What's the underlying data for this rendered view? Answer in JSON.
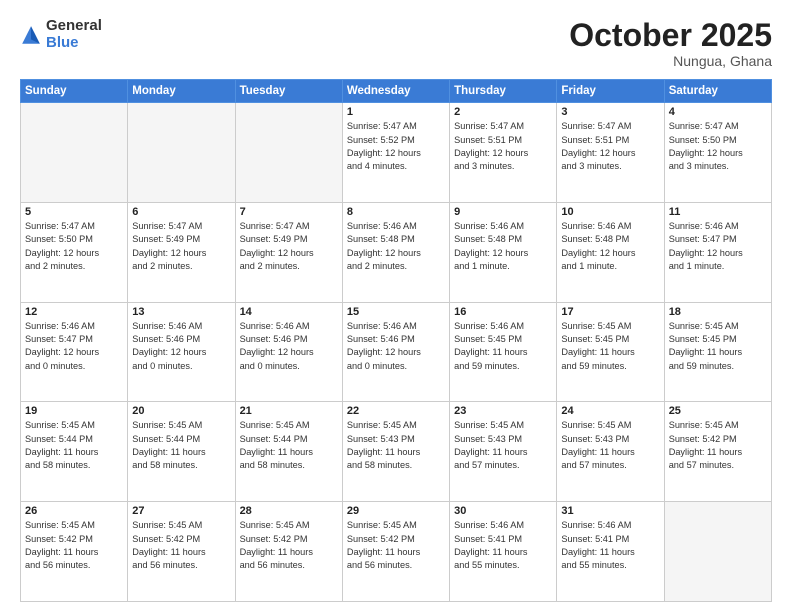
{
  "logo": {
    "general": "General",
    "blue": "Blue"
  },
  "header": {
    "month": "October 2025",
    "location": "Nungua, Ghana"
  },
  "weekdays": [
    "Sunday",
    "Monday",
    "Tuesday",
    "Wednesday",
    "Thursday",
    "Friday",
    "Saturday"
  ],
  "weeks": [
    [
      {
        "day": "",
        "info": ""
      },
      {
        "day": "",
        "info": ""
      },
      {
        "day": "",
        "info": ""
      },
      {
        "day": "1",
        "info": "Sunrise: 5:47 AM\nSunset: 5:52 PM\nDaylight: 12 hours\nand 4 minutes."
      },
      {
        "day": "2",
        "info": "Sunrise: 5:47 AM\nSunset: 5:51 PM\nDaylight: 12 hours\nand 3 minutes."
      },
      {
        "day": "3",
        "info": "Sunrise: 5:47 AM\nSunset: 5:51 PM\nDaylight: 12 hours\nand 3 minutes."
      },
      {
        "day": "4",
        "info": "Sunrise: 5:47 AM\nSunset: 5:50 PM\nDaylight: 12 hours\nand 3 minutes."
      }
    ],
    [
      {
        "day": "5",
        "info": "Sunrise: 5:47 AM\nSunset: 5:50 PM\nDaylight: 12 hours\nand 2 minutes."
      },
      {
        "day": "6",
        "info": "Sunrise: 5:47 AM\nSunset: 5:49 PM\nDaylight: 12 hours\nand 2 minutes."
      },
      {
        "day": "7",
        "info": "Sunrise: 5:47 AM\nSunset: 5:49 PM\nDaylight: 12 hours\nand 2 minutes."
      },
      {
        "day": "8",
        "info": "Sunrise: 5:46 AM\nSunset: 5:48 PM\nDaylight: 12 hours\nand 2 minutes."
      },
      {
        "day": "9",
        "info": "Sunrise: 5:46 AM\nSunset: 5:48 PM\nDaylight: 12 hours\nand 1 minute."
      },
      {
        "day": "10",
        "info": "Sunrise: 5:46 AM\nSunset: 5:48 PM\nDaylight: 12 hours\nand 1 minute."
      },
      {
        "day": "11",
        "info": "Sunrise: 5:46 AM\nSunset: 5:47 PM\nDaylight: 12 hours\nand 1 minute."
      }
    ],
    [
      {
        "day": "12",
        "info": "Sunrise: 5:46 AM\nSunset: 5:47 PM\nDaylight: 12 hours\nand 0 minutes."
      },
      {
        "day": "13",
        "info": "Sunrise: 5:46 AM\nSunset: 5:46 PM\nDaylight: 12 hours\nand 0 minutes."
      },
      {
        "day": "14",
        "info": "Sunrise: 5:46 AM\nSunset: 5:46 PM\nDaylight: 12 hours\nand 0 minutes."
      },
      {
        "day": "15",
        "info": "Sunrise: 5:46 AM\nSunset: 5:46 PM\nDaylight: 12 hours\nand 0 minutes."
      },
      {
        "day": "16",
        "info": "Sunrise: 5:46 AM\nSunset: 5:45 PM\nDaylight: 11 hours\nand 59 minutes."
      },
      {
        "day": "17",
        "info": "Sunrise: 5:45 AM\nSunset: 5:45 PM\nDaylight: 11 hours\nand 59 minutes."
      },
      {
        "day": "18",
        "info": "Sunrise: 5:45 AM\nSunset: 5:45 PM\nDaylight: 11 hours\nand 59 minutes."
      }
    ],
    [
      {
        "day": "19",
        "info": "Sunrise: 5:45 AM\nSunset: 5:44 PM\nDaylight: 11 hours\nand 58 minutes."
      },
      {
        "day": "20",
        "info": "Sunrise: 5:45 AM\nSunset: 5:44 PM\nDaylight: 11 hours\nand 58 minutes."
      },
      {
        "day": "21",
        "info": "Sunrise: 5:45 AM\nSunset: 5:44 PM\nDaylight: 11 hours\nand 58 minutes."
      },
      {
        "day": "22",
        "info": "Sunrise: 5:45 AM\nSunset: 5:43 PM\nDaylight: 11 hours\nand 58 minutes."
      },
      {
        "day": "23",
        "info": "Sunrise: 5:45 AM\nSunset: 5:43 PM\nDaylight: 11 hours\nand 57 minutes."
      },
      {
        "day": "24",
        "info": "Sunrise: 5:45 AM\nSunset: 5:43 PM\nDaylight: 11 hours\nand 57 minutes."
      },
      {
        "day": "25",
        "info": "Sunrise: 5:45 AM\nSunset: 5:42 PM\nDaylight: 11 hours\nand 57 minutes."
      }
    ],
    [
      {
        "day": "26",
        "info": "Sunrise: 5:45 AM\nSunset: 5:42 PM\nDaylight: 11 hours\nand 56 minutes."
      },
      {
        "day": "27",
        "info": "Sunrise: 5:45 AM\nSunset: 5:42 PM\nDaylight: 11 hours\nand 56 minutes."
      },
      {
        "day": "28",
        "info": "Sunrise: 5:45 AM\nSunset: 5:42 PM\nDaylight: 11 hours\nand 56 minutes."
      },
      {
        "day": "29",
        "info": "Sunrise: 5:45 AM\nSunset: 5:42 PM\nDaylight: 11 hours\nand 56 minutes."
      },
      {
        "day": "30",
        "info": "Sunrise: 5:46 AM\nSunset: 5:41 PM\nDaylight: 11 hours\nand 55 minutes."
      },
      {
        "day": "31",
        "info": "Sunrise: 5:46 AM\nSunset: 5:41 PM\nDaylight: 11 hours\nand 55 minutes."
      },
      {
        "day": "",
        "info": ""
      }
    ]
  ]
}
